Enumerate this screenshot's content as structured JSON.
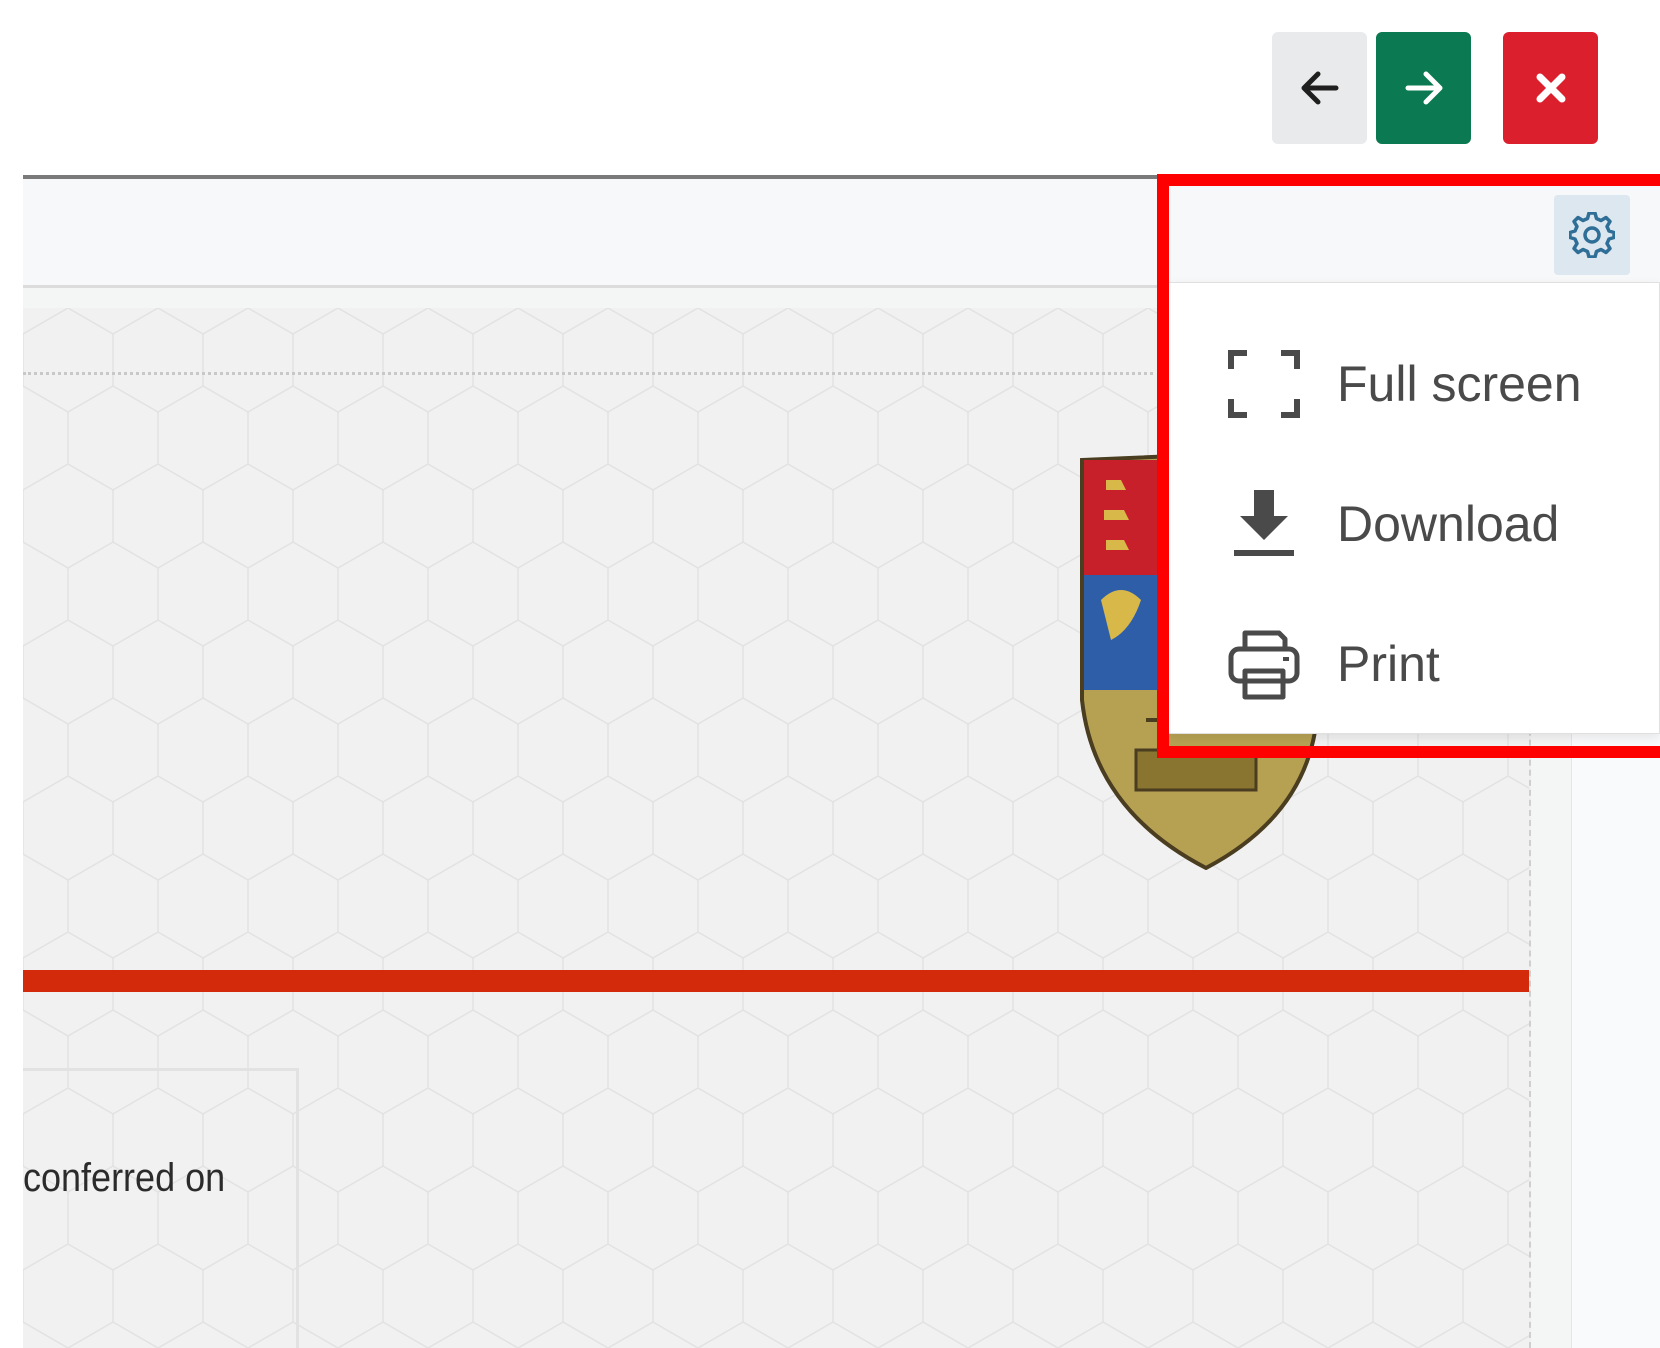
{
  "nav": {
    "back_icon": "arrow-left-icon",
    "next_icon": "arrow-right-icon",
    "close_icon": "close-icon",
    "next_color": "#0b7a52",
    "close_color": "#dc1f2c"
  },
  "toolbar": {
    "settings_icon": "gear-icon",
    "settings_color": "#2f6e96"
  },
  "menu": {
    "items": [
      {
        "label": "Full screen",
        "icon": "fullscreen-icon"
      },
      {
        "label": "Download",
        "icon": "download-icon"
      },
      {
        "label": "Print",
        "icon": "print-icon"
      }
    ]
  },
  "document": {
    "text": "conferred on",
    "accent_color": "#d32a0c",
    "crest_icon": "university-crest-icon"
  },
  "annotation": {
    "highlight_color": "#ff0000"
  }
}
